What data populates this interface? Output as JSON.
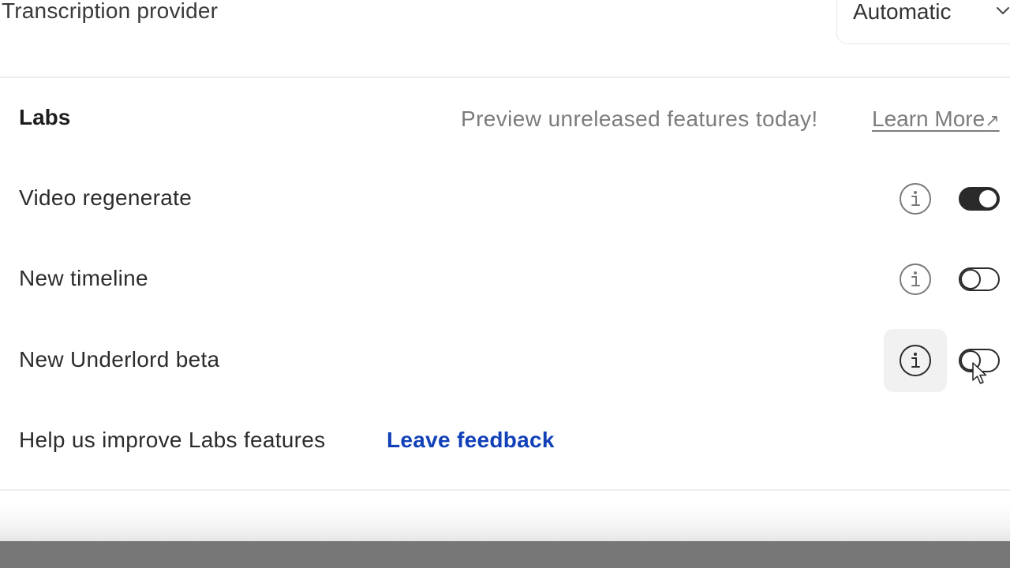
{
  "transcription": {
    "label": "Transcription provider",
    "selected": "Automatic"
  },
  "labs": {
    "title": "Labs",
    "preview_text": "Preview unreleased features today!",
    "learn_more": "Learn More",
    "learn_more_icon": "↗",
    "features": [
      {
        "label": "Video regenerate",
        "enabled": true
      },
      {
        "label": "New timeline",
        "enabled": false
      },
      {
        "label": "New Underlord beta",
        "enabled": false
      }
    ],
    "help_text": "Help us improve Labs features",
    "feedback_link": "Leave feedback"
  },
  "icons": {
    "info": "info-circle-icon",
    "chevron": "chevron-down-icon",
    "cursor": "mouse-pointer-icon"
  },
  "colors": {
    "link": "#1140b8",
    "toggle_on": "#2a2a2a",
    "muted_text": "#7c7c7c"
  }
}
